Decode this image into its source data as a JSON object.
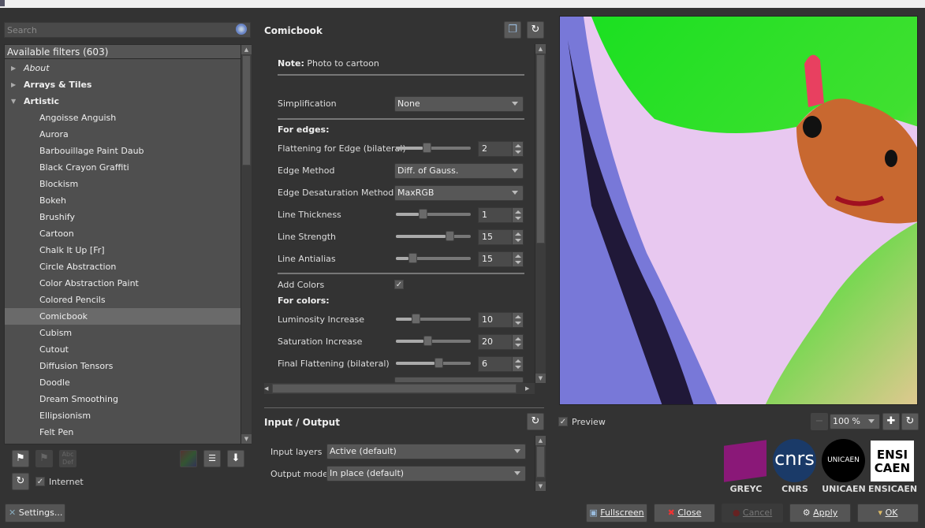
{
  "search": {
    "placeholder": "Search"
  },
  "filters": {
    "header": "Available filters (603)",
    "rows": [
      {
        "type": "cat",
        "label": "About",
        "italic": true,
        "expanded": false
      },
      {
        "type": "cat",
        "label": "Arrays & Tiles",
        "expanded": false
      },
      {
        "type": "cat",
        "label": "Artistic",
        "expanded": true
      },
      {
        "type": "item",
        "label": "Angoisse Anguish"
      },
      {
        "type": "item",
        "label": "Aurora"
      },
      {
        "type": "item",
        "label": "Barbouillage Paint Daub"
      },
      {
        "type": "item",
        "label": "Black Crayon Graffiti"
      },
      {
        "type": "item",
        "label": "Blockism"
      },
      {
        "type": "item",
        "label": "Bokeh"
      },
      {
        "type": "item",
        "label": "Brushify"
      },
      {
        "type": "item",
        "label": "Cartoon"
      },
      {
        "type": "item",
        "label": "Chalk It Up [Fr]"
      },
      {
        "type": "item",
        "label": "Circle Abstraction"
      },
      {
        "type": "item",
        "label": "Color Abstraction Paint"
      },
      {
        "type": "item",
        "label": "Colored Pencils"
      },
      {
        "type": "item",
        "label": "Comicbook",
        "selected": true
      },
      {
        "type": "item",
        "label": "Cubism"
      },
      {
        "type": "item",
        "label": "Cutout"
      },
      {
        "type": "item",
        "label": "Diffusion Tensors"
      },
      {
        "type": "item",
        "label": "Doodle"
      },
      {
        "type": "item",
        "label": "Dream Smoothing"
      },
      {
        "type": "item",
        "label": "Ellipsionism"
      },
      {
        "type": "item",
        "label": "Felt Pen"
      }
    ]
  },
  "left_toolbar": {
    "internet_label": "Internet",
    "internet_checked": true,
    "settings_label": "Settings..."
  },
  "filter": {
    "title": "Comicbook",
    "note_label": "Note:",
    "note_text": "Photo to cartoon",
    "simplification": {
      "label": "Simplification",
      "value": "None"
    },
    "edges_header": "For edges:",
    "flattening_edge": {
      "label": "Flattening for Edge (bilateral)",
      "value": "2",
      "fraction": 0.4
    },
    "edge_method": {
      "label": "Edge Method",
      "value": "Diff. of Gauss."
    },
    "edge_desat": {
      "label": "Edge Desaturation Method",
      "value": "MaxRGB"
    },
    "line_thickness": {
      "label": "Line Thickness",
      "value": "1",
      "fraction": 0.35
    },
    "line_strength": {
      "label": "Line Strength",
      "value": "15",
      "fraction": 0.75
    },
    "line_antialias": {
      "label": "Line Antialias",
      "value": "15",
      "fraction": 0.19
    },
    "add_colors": {
      "label": "Add Colors",
      "checked": true
    },
    "colors_header": "For colors:",
    "luminosity": {
      "label": "Luminosity Increase",
      "value": "10",
      "fraction": 0.24
    },
    "saturation": {
      "label": "Saturation Increase",
      "value": "20",
      "fraction": 0.42
    },
    "final_flattening": {
      "label": "Final Flattening (bilateral)",
      "value": "6",
      "fraction": 0.58
    }
  },
  "io": {
    "title": "Input / Output",
    "input_layers": {
      "label": "Input layers",
      "value": "Active (default)"
    },
    "output_mode": {
      "label": "Output mode",
      "value": "In place (default)"
    }
  },
  "preview": {
    "label": "Preview",
    "checked": true,
    "zoom": "100 %"
  },
  "logos": [
    "GREYC",
    "CNRS",
    "UNICAEN",
    "ENSICAEN"
  ],
  "buttons": {
    "fullscreen": "Fullscreen",
    "close": "Close",
    "cancel": "Cancel",
    "apply": "Apply",
    "ok": "OK"
  }
}
